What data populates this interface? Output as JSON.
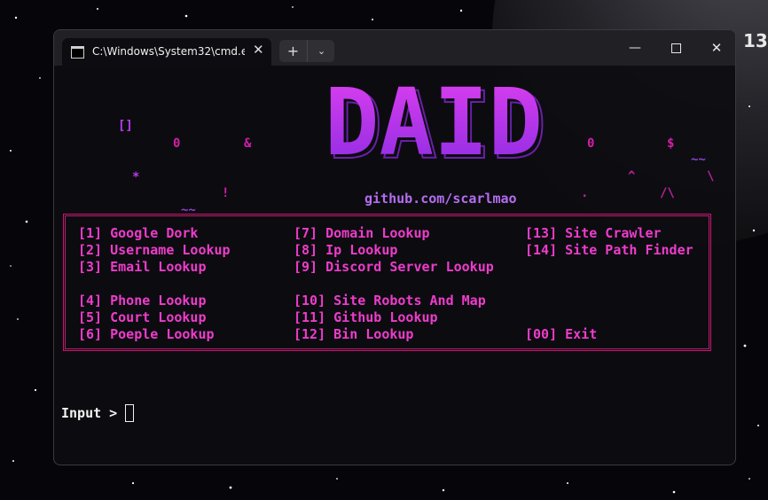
{
  "desktop": {
    "clock_fragment": "13"
  },
  "window": {
    "tab_title": "C:\\Windows\\System32\\cmd.e",
    "tab_icon": "cmd-icon",
    "tab_close": "✕",
    "new_tab": "+",
    "dropdown": "⌄",
    "minimize": "—",
    "close": "✕"
  },
  "ascii_art": {
    "symbols": [
      {
        "text": "[]",
        "color": "#b83cf0"
      },
      {
        "text": "0",
        "color": "#d21ea8"
      },
      {
        "text": "&",
        "color": "#d21ea8"
      },
      {
        "text": "*",
        "color": "#b43ce6"
      },
      {
        "text": "!",
        "color": "#d21ea8"
      },
      {
        "text": "~~",
        "color": "#9040d8"
      },
      {
        "text": "0",
        "color": "#d21ea8"
      },
      {
        "text": "$",
        "color": "#d21ea8"
      },
      {
        "text": "~~",
        "color": "#9040d8"
      },
      {
        "text": "^",
        "color": "#c020a0"
      },
      {
        "text": "\\",
        "color": "#c020a0"
      },
      {
        "text": "/\\",
        "color": "#c020a0"
      },
      {
        "text": ".",
        "color": "#c020a0"
      }
    ],
    "logo": "DAID",
    "colors": {
      "top": "#e040f0",
      "bottom": "#8a2be2",
      "outline": "#6a1fa8"
    }
  },
  "github_link": "github.com/scarlmao",
  "menu": {
    "border_color": "#c4186f",
    "text_color": "#ee3ccb",
    "items": [
      "[1] Google Dork",
      "[2] Username Lookup",
      "[3] Email Lookup",
      "[4] Phone Lookup",
      "[5] Court Lookup",
      "[6] Poeple Lookup",
      "[7] Domain Lookup",
      "[8] Ip Lookup",
      "[9] Discord Server Lookup",
      "[10] Site Robots And Map",
      "[11] Github Lookup",
      "[12] Bin Lookup",
      "[13] Site Crawler",
      "[14] Site Path Finder",
      "[00] Exit"
    ]
  },
  "prompt": "Input > "
}
